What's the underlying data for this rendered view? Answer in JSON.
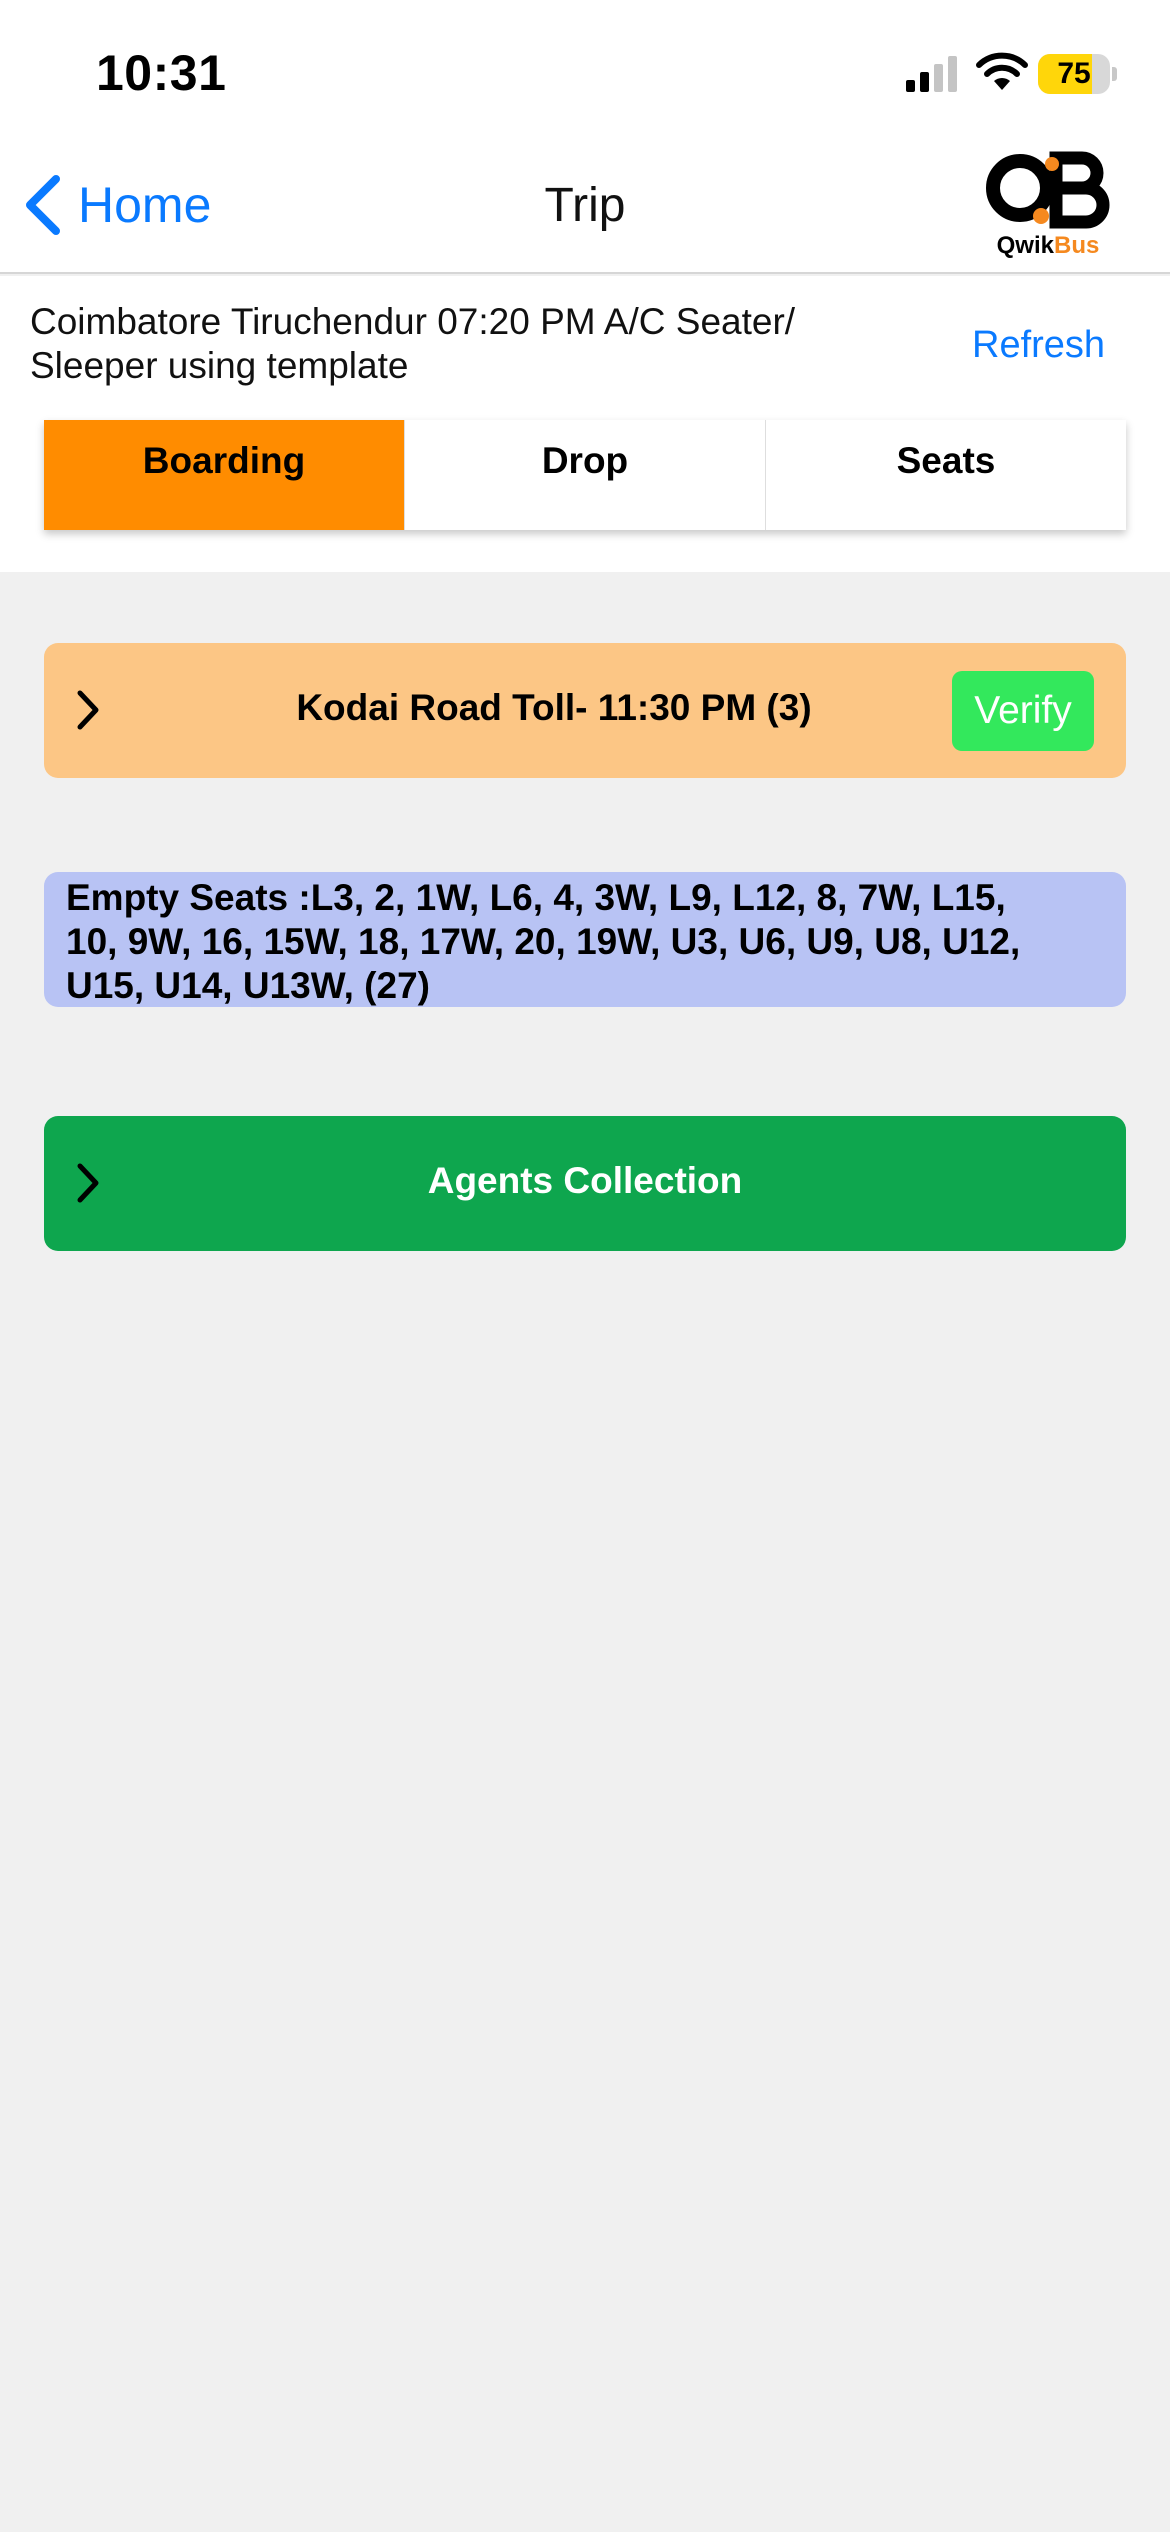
{
  "status_bar": {
    "time": "10:31",
    "battery_percent": "75",
    "battery_level": 0.75,
    "battery_color": "#ffd60a",
    "signal_bars_active": 2,
    "signal_bars_total": 4
  },
  "nav": {
    "back_label": "Home",
    "title": "Trip",
    "brand": {
      "mark": "QB",
      "name_part1": "Qwik",
      "name_part2": "Bus",
      "accent": "#f5891f"
    }
  },
  "trip": {
    "title": "Coimbatore Tiruchendur 07:20 PM A/C Seater/ Sleeper using template",
    "refresh_label": "Refresh"
  },
  "tabs": [
    {
      "label": "Boarding",
      "active": true
    },
    {
      "label": "Drop",
      "active": false
    },
    {
      "label": "Seats",
      "active": false
    }
  ],
  "boarding_point": {
    "label": "Kodai Road Toll- 11:30 PM (3)",
    "verify_label": "Verify"
  },
  "empty_seats": {
    "text": "Empty Seats :L3, 2, 1W, L6, 4, 3W, L9, L12, 8, 7W, L15, 10, 9W, 16, 15W, 18, 17W, 20, 19W, U3, U6, U9, U8, U12, U15, U14, U13W,  (27)"
  },
  "agents_collection": {
    "label": "Agents Collection"
  },
  "colors": {
    "accent_blue": "#0a7aff",
    "active_tab": "#ff8c00",
    "boarding_card": "#fcc685",
    "verify_button": "#33e85c",
    "empty_seats_card": "#b8c3f4",
    "agents_card": "#0ea64e",
    "background": "#f0f0f0"
  },
  "icons": [
    "back-chevron-icon",
    "chevron-right-icon",
    "signal-icon",
    "wifi-icon",
    "battery-icon",
    "qwikbus-logo"
  ]
}
